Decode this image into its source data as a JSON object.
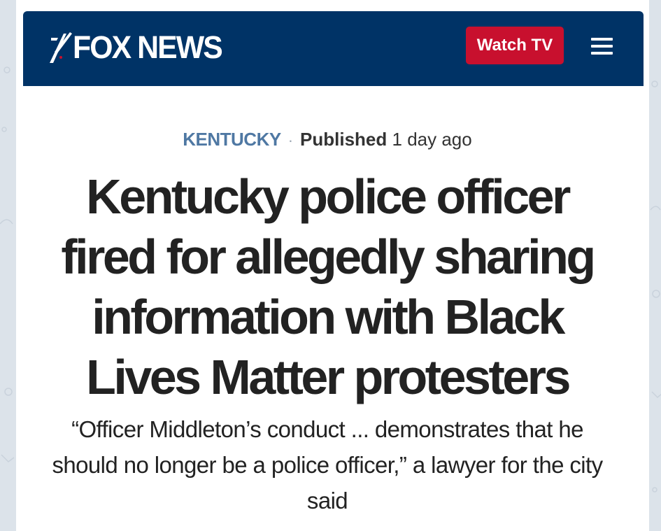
{
  "header": {
    "logo_text": "FOX NEWS",
    "watch_label": "Watch TV",
    "menu_icon": "hamburger-menu-icon"
  },
  "article": {
    "category": "KENTUCKY",
    "separator": "·",
    "published_label": "Published",
    "published_time": "1 day ago",
    "headline": "Kentucky police officer fired for allegedly sharing information with Black Lives Matter protesters",
    "subheadline": "“Officer Middleton’s conduct ... demonstrates that he should no longer be a police officer,” a lawyer for the city said"
  },
  "colors": {
    "header_bg": "#003366",
    "watch_button": "#c8102e",
    "category": "#4f78a3",
    "text": "#222222"
  }
}
